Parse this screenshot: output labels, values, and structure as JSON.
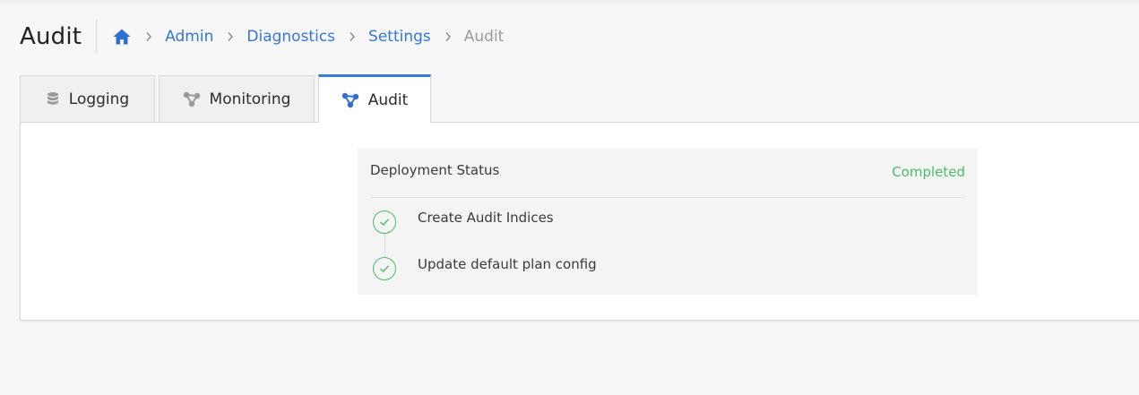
{
  "header": {
    "title": "Audit"
  },
  "breadcrumb": {
    "home_icon": "home-icon",
    "items": [
      {
        "label": "Admin"
      },
      {
        "label": "Diagnostics"
      },
      {
        "label": "Settings"
      }
    ],
    "current": "Audit"
  },
  "tabs": [
    {
      "label": "Logging",
      "icon": "database-icon",
      "active": false
    },
    {
      "label": "Monitoring",
      "icon": "nodes-icon",
      "active": false
    },
    {
      "label": "Audit",
      "icon": "nodes-icon",
      "active": true
    }
  ],
  "deployment": {
    "title": "Deployment Status",
    "status": "Completed",
    "steps": [
      {
        "label": "Create Audit Indices",
        "state": "done"
      },
      {
        "label": "Update default plan config",
        "state": "done"
      }
    ]
  },
  "colors": {
    "accent": "#3a7be0",
    "link": "#3576d5",
    "success": "#4cbb6a",
    "muted": "#9a9a9a"
  }
}
